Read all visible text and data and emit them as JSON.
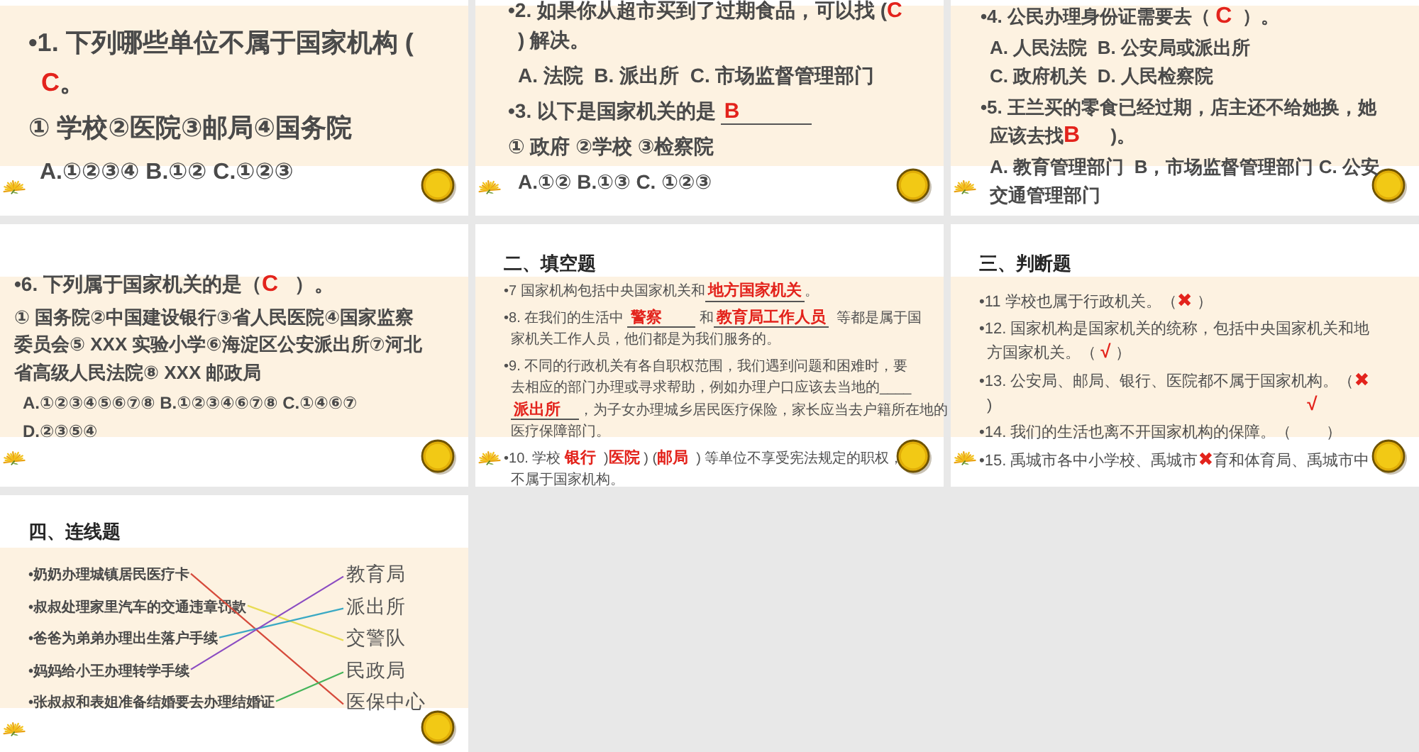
{
  "slides": [
    {
      "kind": "questions",
      "paragraphs": [
        {
          "kind": "question",
          "lines": [
            [
              {
                "kind": "text",
                "text": "•1. 下列哪些单位不属于国家机构 ("
              }
            ],
            [
              {
                "kind": "answer",
                "text": "C"
              },
              {
                "kind": "text",
                "text": "。"
              }
            ]
          ]
        },
        {
          "kind": "items",
          "lines": [
            [
              {
                "kind": "text",
                "text": "① 学校②医院③邮局④国务院"
              }
            ]
          ]
        },
        {
          "kind": "options",
          "lines": [
            [
              {
                "kind": "text",
                "text": "A.①②③④ B.①② C.①②③"
              }
            ]
          ]
        }
      ]
    },
    {
      "kind": "questions",
      "paragraphs": [
        {
          "kind": "question",
          "lines": [
            [
              {
                "kind": "text",
                "text": "•2. 如果你从超市买到了过期食品，可以找 ("
              },
              {
                "kind": "answer",
                "text": "C"
              }
            ],
            [
              {
                "kind": "text",
                "text": ") 解决。"
              }
            ]
          ]
        },
        {
          "kind": "options",
          "lines": [
            [
              {
                "kind": "text",
                "text": "A. 法院  B. 派出所  C. 市场监督管理部门"
              }
            ]
          ]
        },
        {
          "kind": "question",
          "lines": [
            [
              {
                "kind": "text",
                "text": "•3. 以下是国家机关的是 "
              },
              {
                "kind": "blank",
                "text": "B"
              }
            ]
          ]
        },
        {
          "kind": "items",
          "lines": [
            [
              {
                "kind": "text",
                "text": "① 政府 ②学校 ③检察院"
              }
            ]
          ]
        },
        {
          "kind": "options",
          "lines": [
            [
              {
                "kind": "text",
                "text": "A.①② B.①③ C. ①②③"
              }
            ]
          ]
        }
      ]
    },
    {
      "kind": "questions",
      "paragraphs": [
        {
          "kind": "question",
          "lines": [
            [
              {
                "kind": "text",
                "text": "•4. 公民办理身份证需要去（ "
              },
              {
                "kind": "answer",
                "text": "C"
              },
              {
                "kind": "text",
                "text": "  ）。"
              }
            ]
          ]
        },
        {
          "kind": "options",
          "lines": [
            [
              {
                "kind": "text",
                "text": "A. 人民法院  B. 公安局或派出所"
              }
            ],
            [
              {
                "kind": "text",
                "text": "C. 政府机关  D. 人民检察院"
              }
            ]
          ]
        },
        {
          "kind": "question",
          "lines": [
            [
              {
                "kind": "text",
                "text": "•5. 王兰买的零食已经过期，店主还不给她换，她"
              }
            ],
            [
              {
                "kind": "text",
                "text": "应该去找"
              },
              {
                "kind": "answer",
                "text": "B"
              },
              {
                "kind": "text",
                "text": "      )。"
              }
            ]
          ]
        },
        {
          "kind": "options",
          "lines": [
            [
              {
                "kind": "text",
                "text": "A. 教育管理部门  B，市场监督管理部门 C. 公安"
              }
            ],
            [
              {
                "kind": "text",
                "text": "交通管理部门"
              }
            ]
          ]
        }
      ]
    },
    {
      "kind": "questions",
      "paragraphs": [
        {
          "kind": "question",
          "lines": [
            [
              {
                "kind": "text",
                "text": "•6. 下列属于国家机关的是（"
              },
              {
                "kind": "answer",
                "text": "C"
              },
              {
                "kind": "text",
                "text": "   ）。"
              }
            ]
          ]
        },
        {
          "kind": "items",
          "lines": [
            [
              {
                "kind": "text",
                "text": "① 国务院②中国建设银行③省人民医院④国家监察"
              }
            ],
            [
              {
                "kind": "text",
                "text": "委员会⑤ XXX 实验小学⑥海淀区公安派出所⑦河北"
              }
            ],
            [
              {
                "kind": "text",
                "text": "省高级人民法院⑧ XXX 邮政局"
              }
            ]
          ]
        },
        {
          "kind": "options",
          "lines": [
            [
              {
                "kind": "text",
                "text": "A.①②③④⑤⑥⑦⑧ B.①②③④⑥⑦⑧ C.①④⑥⑦"
              }
            ],
            [
              {
                "kind": "text",
                "text": "D.②③⑤④"
              }
            ]
          ]
        }
      ]
    },
    {
      "kind": "questions",
      "heading": "二、填空题",
      "paragraphs": [
        {
          "kind": "question",
          "lines": [
            [
              {
                "kind": "text",
                "text": "•7 国家机构包括中央国家机关和"
              },
              {
                "kind": "blank",
                "text": "地方国家机关"
              },
              {
                "kind": "text",
                "text": "。"
              }
            ]
          ]
        },
        {
          "kind": "question",
          "lines": [
            [
              {
                "kind": "text",
                "text": "•8. 在我们的生活中 "
              },
              {
                "kind": "blank",
                "text": "警察"
              },
              {
                "kind": "text",
                "text": " 和"
              },
              {
                "kind": "blank",
                "text": "教育局工作人员"
              },
              {
                "kind": "text",
                "text": "  等都是属于国"
              }
            ],
            [
              {
                "kind": "text",
                "text": "家机关工作人员，他们都是为我们服务的。"
              }
            ]
          ]
        },
        {
          "kind": "question",
          "lines": [
            [
              {
                "kind": "text",
                "text": "•9. 不同的行政机关有各自职权范围，我们遇到问题和困难时，要"
              }
            ],
            [
              {
                "kind": "text",
                "text": "去相应的部门办理或寻求帮助，例如办理户口应该去当地的____"
              }
            ],
            [
              {
                "kind": "blank",
                "text": "派出所"
              },
              {
                "kind": "text",
                "text": "，为子女办理城乡居民医疗保险，家长应当去户籍所在地的"
              }
            ],
            [
              {
                "kind": "text",
                "text": "医疗保障部门。"
              }
            ]
          ]
        },
        {
          "kind": "question",
          "lines": [
            [
              {
                "kind": "text",
                "text": "•10. 学校 "
              },
              {
                "kind": "answer",
                "text": "银行"
              },
              {
                "kind": "text",
                "text": "  )"
              },
              {
                "kind": "answer",
                "text": "医院"
              },
              {
                "kind": "text",
                "text": " ) ("
              },
              {
                "kind": "answer",
                "text": "邮局"
              },
              {
                "kind": "text",
                "text": "  ) 等单位不享受宪法规定的职权，"
              }
            ],
            [
              {
                "kind": "text",
                "text": "不属于国家机构。"
              }
            ]
          ]
        }
      ]
    },
    {
      "kind": "questions",
      "heading": "三、判断题",
      "paragraphs": [
        {
          "kind": "question",
          "lines": [
            [
              {
                "kind": "text",
                "text": "•11 学校也属于行政机关。（"
              },
              {
                "kind": "answer",
                "text": "✖"
              },
              {
                "kind": "text",
                "text": " ）"
              }
            ]
          ]
        },
        {
          "kind": "question",
          "lines": [
            [
              {
                "kind": "text",
                "text": "•12. 国家机构是国家机关的统称，包括中央国家机关和地"
              }
            ],
            [
              {
                "kind": "text",
                "text": "方国家机关。（ "
              },
              {
                "kind": "answer",
                "text": "√"
              },
              {
                "kind": "text",
                "text": " ）"
              }
            ]
          ]
        },
        {
          "kind": "question",
          "lines": [
            [
              {
                "kind": "text",
                "text": "•13. 公安局、邮局、银行、医院都不属于国家机构。（"
              },
              {
                "kind": "answer",
                "text": "✖"
              }
            ],
            [
              {
                "kind": "text",
                "text": ")"
              },
              {
                "kind": "aside",
                "text": "√"
              }
            ]
          ]
        },
        {
          "kind": "question",
          "lines": [
            [
              {
                "kind": "text",
                "text": "•14. 我们的生活也离不开国家机构的保障。（        ）"
              }
            ]
          ]
        },
        {
          "kind": "question",
          "lines": [
            [
              {
                "kind": "text",
                "text": "•15. 禹城市各中小学校、禹城市"
              },
              {
                "kind": "answer",
                "text": "✖"
              },
              {
                "kind": "text",
                "text": "育和体育局、禹城市中"
              }
            ]
          ]
        }
      ]
    },
    {
      "kind": "matching",
      "heading": "四、连线题",
      "left": [
        {
          "text": "•奶奶办理城镇居民医疗卡",
          "links": [
            false,
            false,
            false,
            false,
            true
          ]
        },
        {
          "text": "•叔叔处理家里汽车的交通违章罚款",
          "links": [
            false,
            false,
            true,
            false,
            false
          ]
        },
        {
          "text": "•爸爸为弟弟办理出生落户手续",
          "links": [
            false,
            true,
            false,
            false,
            false
          ]
        },
        {
          "text": "•妈妈给小王办理转学手续",
          "links": [
            true,
            false,
            false,
            false,
            false
          ]
        },
        {
          "text": "•张叔叔和表姐准备结婚要去办理结婚证",
          "links": [
            false,
            false,
            false,
            true,
            false
          ]
        }
      ],
      "right": [
        "教育局",
        "派出所",
        "交警队",
        "民政局",
        "医保中心"
      ]
    }
  ]
}
